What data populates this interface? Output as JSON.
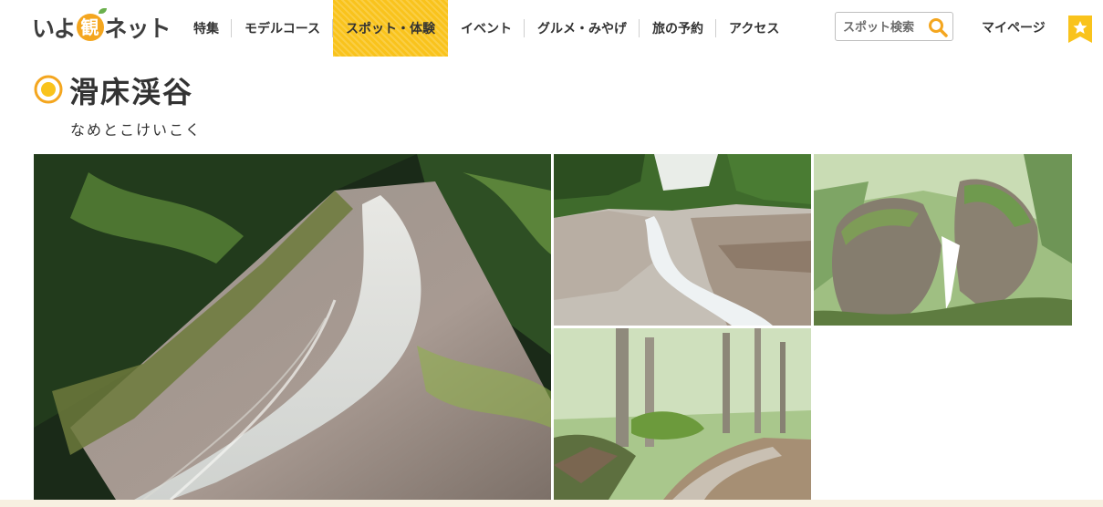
{
  "site": {
    "logo_pre": "いよ",
    "logo_kan": "観",
    "logo_post": "ネット"
  },
  "nav": [
    {
      "label": "特集",
      "active": false
    },
    {
      "label": "モデルコース",
      "active": false
    },
    {
      "label": "スポット・体験",
      "active": true
    },
    {
      "label": "イベント",
      "active": false
    },
    {
      "label": "グルメ・みやげ",
      "active": false
    },
    {
      "label": "旅の予約",
      "active": false
    },
    {
      "label": "アクセス",
      "active": false
    }
  ],
  "search": {
    "placeholder": "スポット検索"
  },
  "user": {
    "mypage_label": "マイページ"
  },
  "colors": {
    "accent": "#f9c31c",
    "brand_orange": "#f4a61f",
    "text": "#333333"
  },
  "page": {
    "title": "滑床渓谷",
    "reading": "なめとこけいこく"
  },
  "gallery": [
    {
      "name": "waterfall-slide-photo"
    },
    {
      "name": "river-rapids-photo"
    },
    {
      "name": "split-boulder-photo"
    },
    {
      "name": "forest-trail-photo"
    }
  ]
}
